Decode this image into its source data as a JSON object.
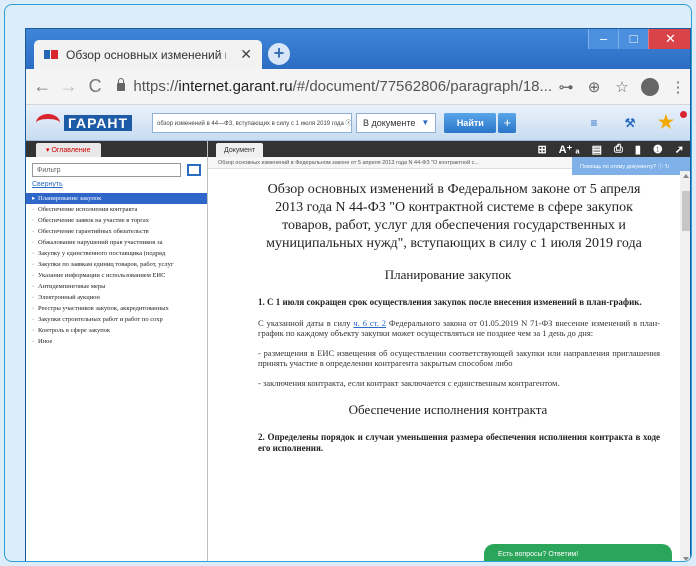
{
  "browser": {
    "tab_title": "Обзор основных изменений в Г",
    "tab_close": "✕",
    "new_tab": "+",
    "window_buttons": [
      "–",
      "□",
      "✕"
    ],
    "url_prefix": "https://",
    "url_host": "internet.garant.ru",
    "url_path": "/#/document/77562806/paragraph/18...",
    "nav_back": "←",
    "nav_forward": "→",
    "nav_reload": "C",
    "icon_key": "⊶",
    "icon_zoom": "⊕",
    "icon_star": "☆",
    "icon_menu": "⋮"
  },
  "garant": {
    "logo_text": "ГАРАНТ",
    "search_value": "обзор изменений в 44—ФЗ, вступающих в силу с 1 июля 2019 года  ⓧ",
    "scope_value": "В документе",
    "scope_caret": "▼",
    "find_label": "Найти",
    "find_plus": "+",
    "icon_filter": "≡",
    "icon_briefcase": "⚒",
    "icon_star": "★"
  },
  "left_panel": {
    "tab_label": "▾ Оглавление",
    "filter_placeholder": "Фильтр",
    "collapse_link": "Свернуть",
    "items": [
      "Планирование закупок",
      "Обеспечение исполнения контракта",
      "Обеспечение заявок на участие в торгах",
      "Обеспечение гарантийных обязательств",
      "Обжалование нарушений прав участников за",
      "Закупку у единственного поставщика (подряд",
      "Закупки по заявкам единиц товаров, работ, услуг",
      "Указание информации с использованием ЕИС",
      "Антидемпинговые меры",
      "Электронный аукцион",
      "Реестры участников закупок, аккредитованных",
      "Закупки строительных работ и работ по сохр",
      "Контроль в сфере закупок",
      "Иное"
    ]
  },
  "doc_panel": {
    "tab_label": "Документ",
    "tools": [
      "⊞",
      "A⁺ ₐ",
      "▤",
      "⎙",
      "▮",
      "❶",
      "➚"
    ],
    "breadcrumb": "Обзор основных изменений в Федеральном законе от 5 апреля 2013 года N 44-ФЗ \"О контрактной с...",
    "ask_label": "Помощь по этому документу?  ⓘ ↻"
  },
  "document": {
    "title": "Обзор основных изменений в Федеральном законе от 5 апреля 2013 года N 44-ФЗ \"О контрактной системе в сфере закупок товаров, работ, услуг для обеспечения государственных и муниципальных нужд\", вступающих в силу с 1 июля 2019 года",
    "section1_heading": "Планирование закупок",
    "item1_heading": "1. С 1 июля сокращен срок осуществления закупок после внесения изменений в план-график.",
    "item1_p1_before": "С указанной даты в силу ",
    "item1_p1_link": "ч. 6 ст. 2",
    "item1_p1_after": " Федерального закона от 01.05.2019 N 71-ФЗ внесение изменений в план-график по каждому объекту закупки может осуществляться не позднее чем за 1 день до дня:",
    "item1_p2": "- размещения в ЕИС извещения об осуществлении соответствующей закупки или направления приглашения принять участие в определении контрагента закрытым способом либо",
    "item1_p3": "- заключения контракта, если контракт заключается с единственным контрагентом.",
    "section2_heading": "Обеспечение исполнения контракта",
    "item2_heading": "2. Определены порядок и случаи уменьшения размера обеспечения исполнения контракта в ходе его исполнения."
  },
  "chat_label": "Есть вопросы? Ответим!",
  "colors": {
    "frame_border": "#2f9fd8",
    "window_titlebar": "#3f86d8",
    "active_toc": "#2e66c9",
    "chat": "#2aa55a",
    "accent_red": "#d9262e"
  }
}
